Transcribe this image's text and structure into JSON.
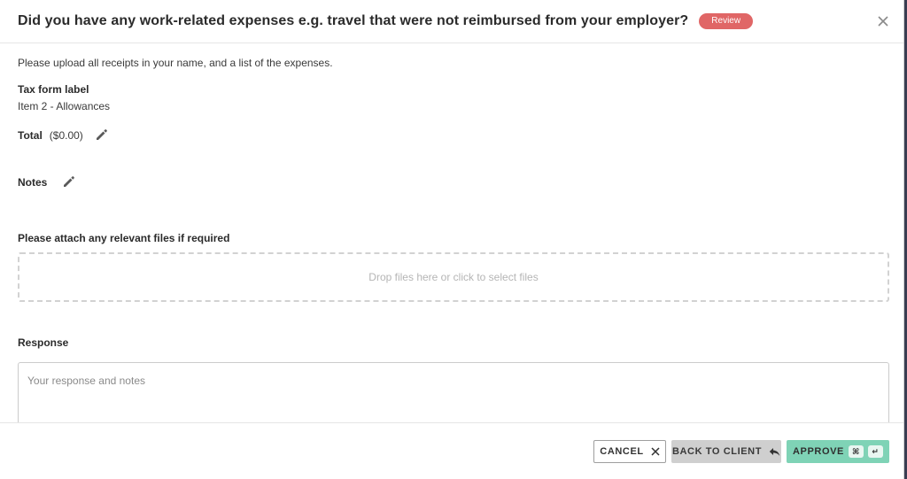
{
  "dialog": {
    "title": "Did you have any work-related expenses e.g. travel that were not reimbursed from your employer?",
    "badge": "Review",
    "close_icon": "close-icon"
  },
  "content": {
    "intro": "Please upload all receipts in your name, and a list of the expenses.",
    "tax_form_label_title": "Tax form label",
    "tax_form_label_value": "Item 2 - Allowances",
    "total_label": "Total",
    "total_amount": "($0.00)",
    "notes_label": "Notes",
    "attach_label": "Please attach any relevant files if required",
    "dropzone_text": "Drop files here or click to select files",
    "response_label": "Response",
    "response_placeholder": "Your response and notes",
    "response_value": ""
  },
  "footer": {
    "cancel_label": "CANCEL",
    "back_label": "BACK TO CLIENT",
    "approve_label": "APPROVE",
    "approve_shortcut": [
      "⌘",
      "↵"
    ]
  },
  "colors": {
    "badge": "#e06666",
    "approve": "#7fd3b6",
    "back": "#cfcfcf"
  }
}
